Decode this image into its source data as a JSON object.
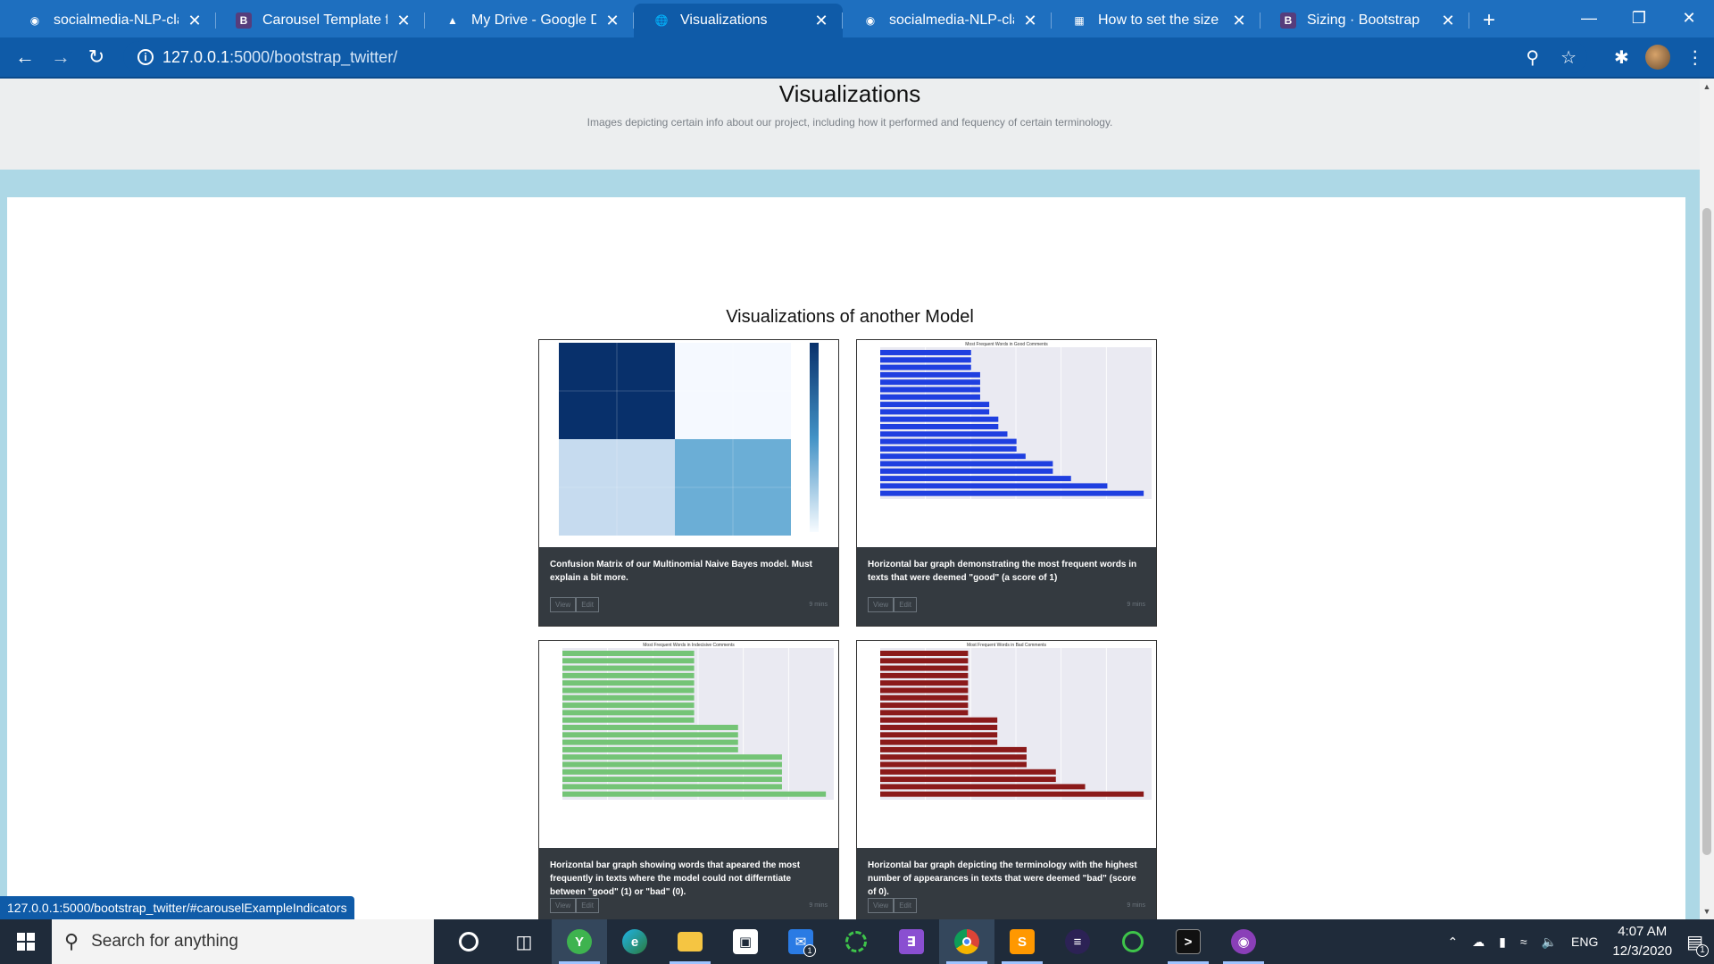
{
  "browser": {
    "tabs": [
      {
        "title": "socialmedia-NLP-classi",
        "icon": "github-icon",
        "active": false
      },
      {
        "title": "Carousel Template for",
        "icon": "bootstrap-icon",
        "active": false
      },
      {
        "title": "My Drive - Google Driv",
        "icon": "google-drive-icon",
        "active": false
      },
      {
        "title": "Visualizations",
        "icon": "globe-icon",
        "active": true
      },
      {
        "title": "socialmedia-NLP-classi",
        "icon": "github-icon",
        "active": false
      },
      {
        "title": "How to set the size of",
        "icon": "microsoft-icon",
        "active": false
      },
      {
        "title": "Sizing · Bootstrap",
        "icon": "bootstrap-icon",
        "active": false
      }
    ],
    "url_host": "127.0.0.1",
    "url_path": ":5000/bootstrap_twitter/",
    "status_url": "127.0.0.1:5000/bootstrap_twitter/#carouselExampleIndicators"
  },
  "page": {
    "title": "Visualizations",
    "subtitle": "Images depicting certain info about our project, including how it performed and fequency of certain terminology.",
    "section_title": "Visualizations of another Model",
    "cards": [
      {
        "caption": "Confusion Matrix of our Multinomial Naive Bayes model. Must explain a bit more.",
        "view_label": "View",
        "edit_label": "Edit",
        "time": "9 mins"
      },
      {
        "caption": "Horizontal bar graph demonstrating the most frequent words in texts that were deemed \"good\" (a score of 1)",
        "view_label": "View",
        "edit_label": "Edit",
        "time": "9 mins"
      },
      {
        "caption": "Horizontal bar graph showing words that apeared the most frequently in texts where the model could not differntiate between \"good\" (1) or \"bad\" (0).",
        "view_label": "View",
        "edit_label": "Edit",
        "time": "9 mins"
      },
      {
        "caption": "Horizontal bar graph depicting the terminology with the highest number of appearances in texts that were deemed \"bad\" (score of 0).",
        "view_label": "View",
        "edit_label": "Edit",
        "time": "9 mins"
      }
    ]
  },
  "charts": {
    "good": {
      "title": "Most Frequent Words in Good Comments",
      "color": "#1f3fe0",
      "values": [
        10,
        10,
        10,
        11,
        11,
        11,
        11,
        12,
        12,
        13,
        13,
        14,
        15,
        15,
        16,
        19,
        19,
        21,
        25,
        29
      ]
    },
    "indecisive": {
      "title": "Most Frequent Words in Indecisive Comments",
      "color": "#74c476",
      "values": [
        3,
        3,
        3,
        3,
        3,
        3,
        3,
        3,
        3,
        3,
        4,
        4,
        4,
        4,
        5,
        5,
        5,
        5,
        5,
        6
      ]
    },
    "bad": {
      "title": "Most Frequent Words in Bad Comments",
      "color": "#8b1a1a",
      "values": [
        3,
        3,
        3,
        3,
        3,
        3,
        3,
        3,
        3,
        4,
        4,
        4,
        4,
        5,
        5,
        5,
        6,
        6,
        7,
        9
      ]
    },
    "confusion": {
      "colors": [
        "#08306b",
        "#f5f9ff",
        "#c6dbef",
        "#6baed6"
      ]
    }
  },
  "taskbar": {
    "search_placeholder": "Search for anything",
    "time": "4:07 AM",
    "date": "12/3/2020",
    "language": "ENG",
    "notification_count": "1",
    "mail_count": "1"
  }
}
